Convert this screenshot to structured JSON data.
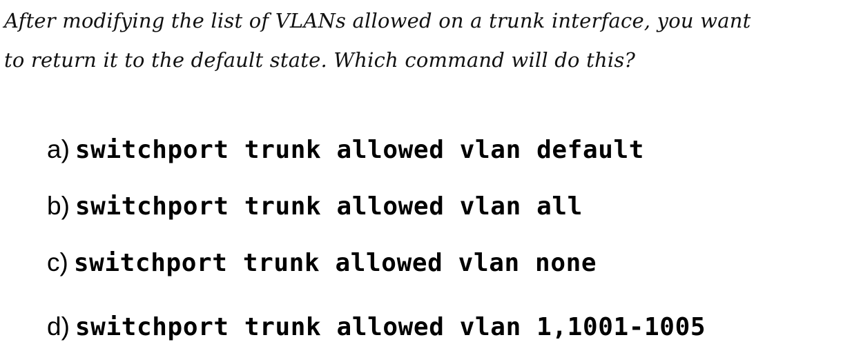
{
  "question": {
    "line1": "After modifying the list of VLANs allowed on a trunk interface, you want",
    "line2": "to return it to the default state.  Which command will do this?"
  },
  "options": [
    {
      "letter": "a)",
      "command": "switchport trunk allowed vlan default"
    },
    {
      "letter": "b)",
      "command": "switchport trunk allowed vlan all"
    },
    {
      "letter": "c)",
      "command": "switchport trunk allowed vlan none"
    },
    {
      "letter": "d)",
      "command": "switchport trunk allowed vlan 1,1001-1005"
    }
  ]
}
